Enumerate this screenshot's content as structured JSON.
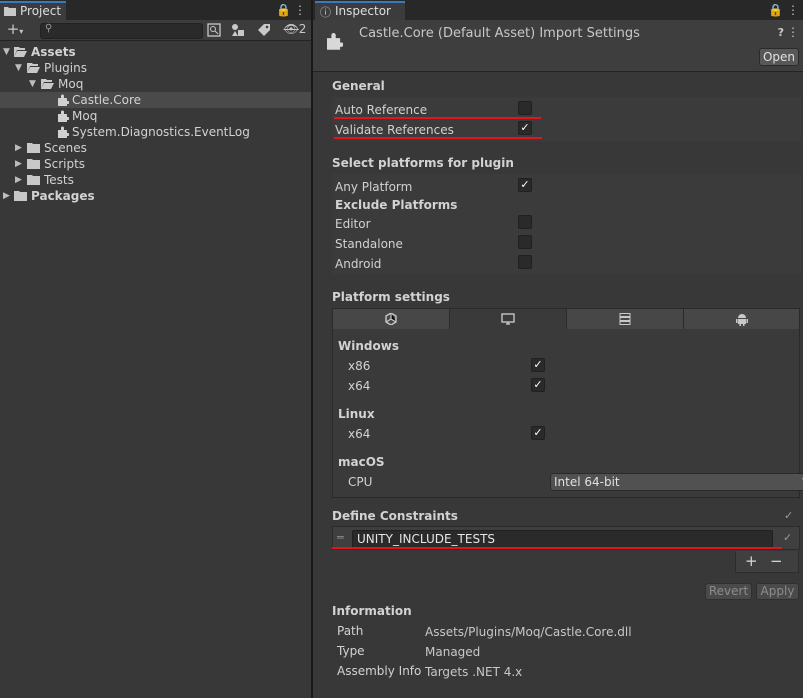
{
  "project": {
    "tab_label": "Project",
    "hidden_count": "2",
    "search": {
      "placeholder": "",
      "value": ""
    },
    "tree": [
      {
        "label": "Assets",
        "bold": true,
        "kind": "folder-open"
      },
      {
        "label": "Plugins",
        "bold": false,
        "kind": "folder-open"
      },
      {
        "label": "Moq",
        "bold": false,
        "kind": "folder-open"
      },
      {
        "label": "Castle.Core",
        "bold": false,
        "kind": "plugin",
        "selected": true
      },
      {
        "label": "Moq",
        "bold": false,
        "kind": "plugin"
      },
      {
        "label": "System.Diagnostics.EventLog",
        "bold": false,
        "kind": "plugin"
      },
      {
        "label": "Scenes",
        "bold": false,
        "kind": "folder"
      },
      {
        "label": "Scripts",
        "bold": false,
        "kind": "folder"
      },
      {
        "label": "Tests",
        "bold": false,
        "kind": "folder"
      },
      {
        "label": "Packages",
        "bold": true,
        "kind": "folder"
      }
    ]
  },
  "inspector": {
    "tab_label": "Inspector",
    "title": "Castle.Core (Default Asset) Import Settings",
    "open_label": "Open",
    "general": {
      "title": "General",
      "auto_reference": {
        "label": "Auto Reference",
        "checked": false
      },
      "validate_references": {
        "label": "Validate References",
        "checked": true
      }
    },
    "platforms": {
      "title": "Select platforms for plugin",
      "any_platform": {
        "label": "Any Platform",
        "checked": true
      },
      "exclude_title": "Exclude Platforms",
      "exclude": [
        {
          "label": "Editor",
          "checked": false
        },
        {
          "label": "Standalone",
          "checked": false
        },
        {
          "label": "Android",
          "checked": false
        }
      ]
    },
    "platform_settings": {
      "title": "Platform settings",
      "tabs": [
        "unity-icon",
        "desktop-icon",
        "server-icon",
        "android-icon"
      ],
      "active_tab": 1,
      "windows": {
        "title": "Windows",
        "x86": {
          "label": "x86",
          "checked": true
        },
        "x64": {
          "label": "x64",
          "checked": true
        }
      },
      "linux": {
        "title": "Linux",
        "x64": {
          "label": "x64",
          "checked": true
        }
      },
      "macos": {
        "title": "macOS",
        "cpu_label": "CPU",
        "cpu_value": "Intel 64-bit"
      }
    },
    "define_constraints": {
      "title": "Define Constraints",
      "value": "UNITY_INCLUDE_TESTS",
      "add": "+",
      "remove": "−"
    },
    "revert_label": "Revert",
    "apply_label": "Apply",
    "information": {
      "title": "Information",
      "path_key": "Path",
      "path_val": "Assets/Plugins/Moq/Castle.Core.dll",
      "type_key": "Type",
      "type_val": "Managed",
      "assembly_key": "Assembly Info",
      "assembly_val": "Targets .NET 4.x"
    }
  },
  "colors": {
    "accent": "#3a79bb",
    "highlight": "#e3141c"
  }
}
